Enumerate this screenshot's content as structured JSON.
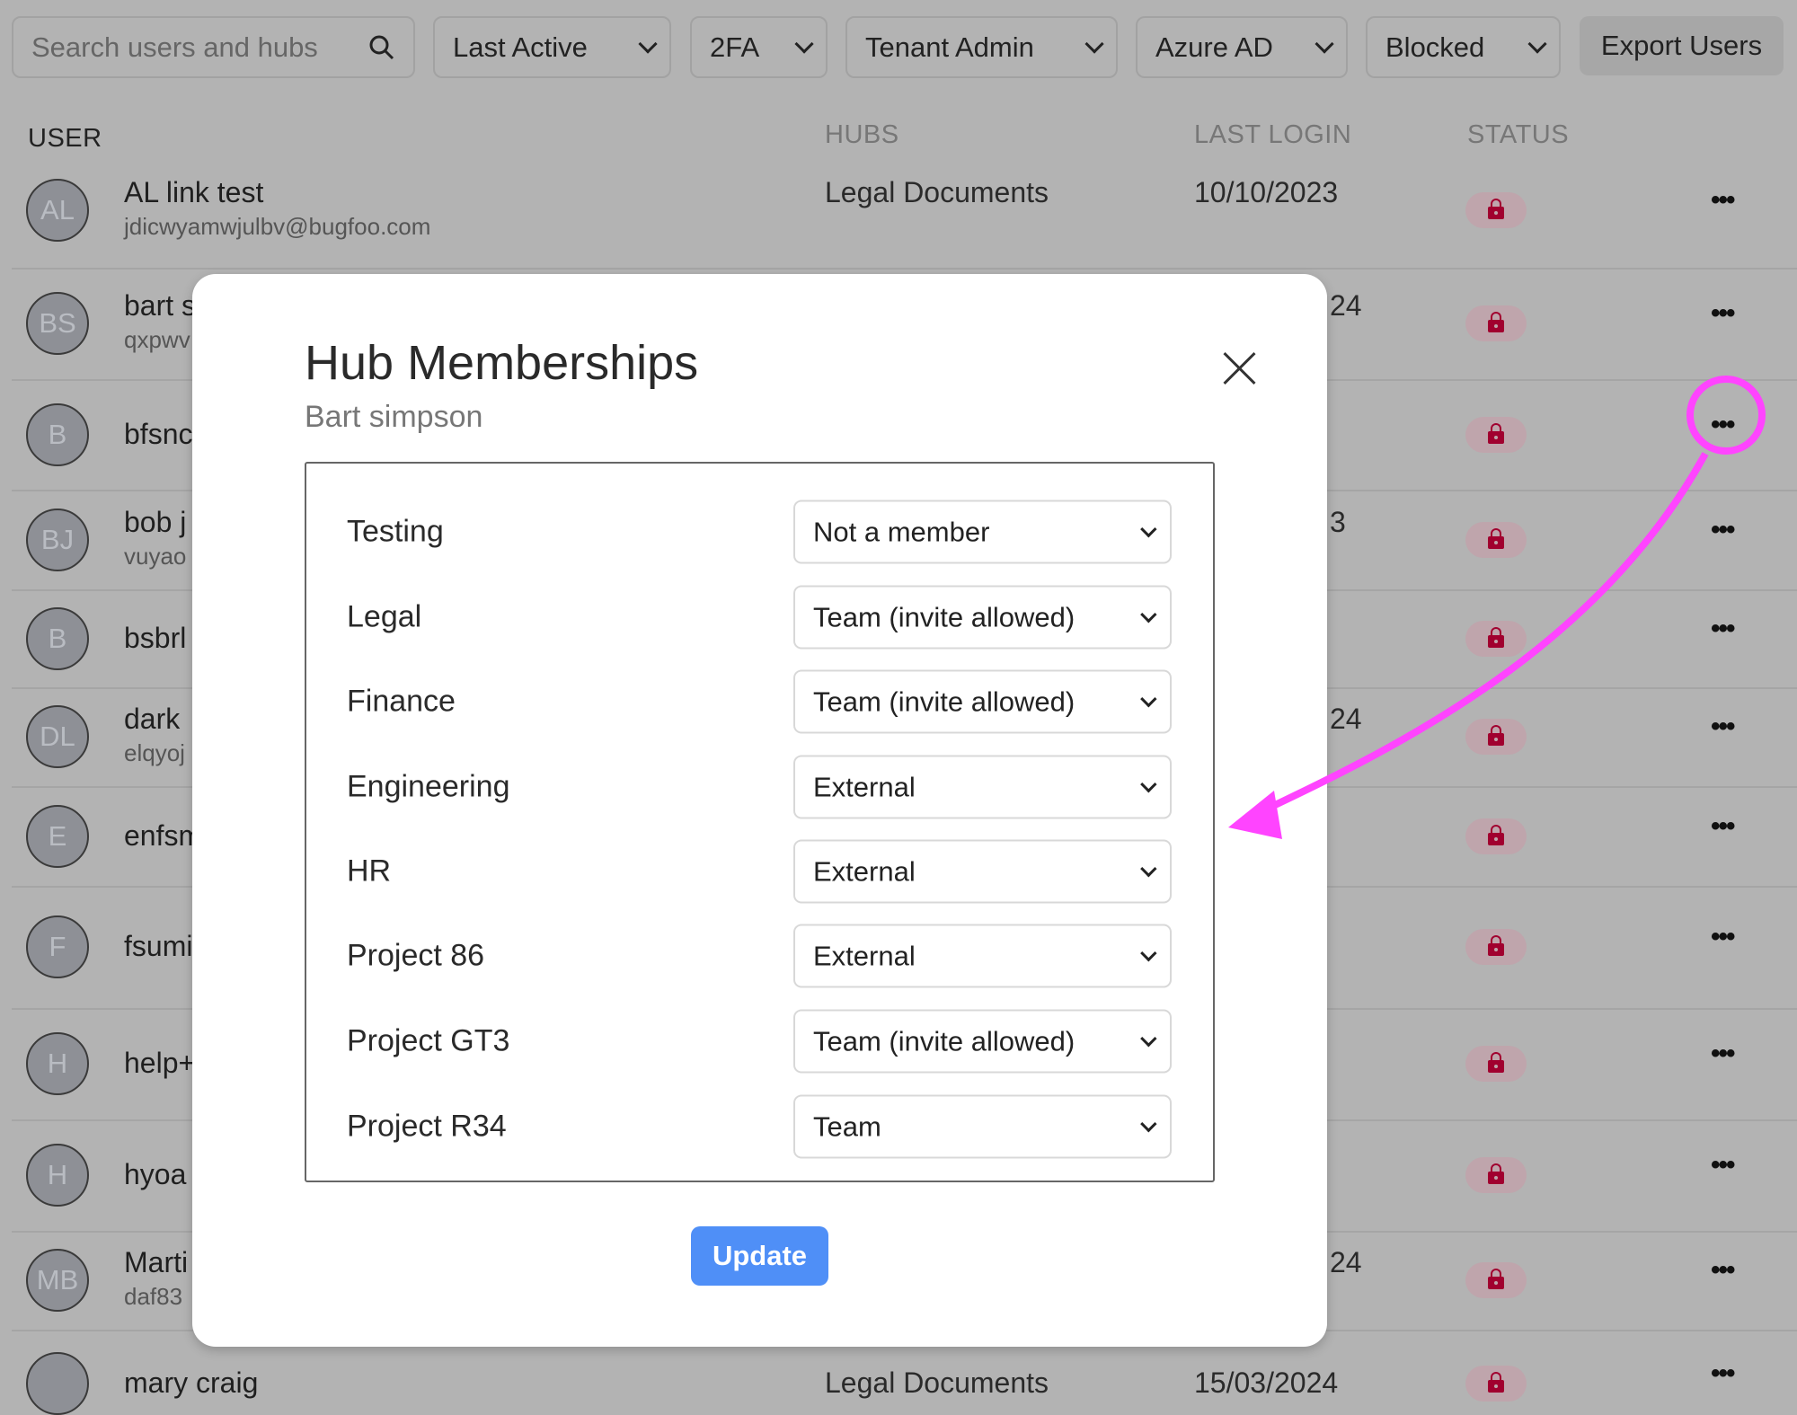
{
  "toolbar": {
    "search_placeholder": "Search users and hubs",
    "filters": [
      "Last Active",
      "2FA",
      "Tenant Admin",
      "Azure AD",
      "Blocked"
    ],
    "export_label": "Export Users"
  },
  "table": {
    "headers": {
      "user": "USER",
      "hubs": "HUBS",
      "last_login": "LAST LOGIN",
      "status": "STATUS"
    },
    "rows": [
      {
        "initials": "AL",
        "name": "AL link test",
        "email": "jdicwyamwjulbv@bugfoo.com",
        "hubs": "Legal Documents",
        "last_login": "10/10/2023",
        "status": "blocked"
      },
      {
        "initials": "BS",
        "name": "bart s",
        "email": "qxpwv",
        "hubs": "",
        "last_login": "24",
        "status": "blocked"
      },
      {
        "initials": "B",
        "name": "bfsnc",
        "email": "",
        "hubs": "",
        "last_login": "",
        "status": "blocked"
      },
      {
        "initials": "BJ",
        "name": "bob j",
        "email": "vuyao",
        "hubs": "",
        "last_login": "3",
        "status": "blocked"
      },
      {
        "initials": "B",
        "name": "bsbrl",
        "email": "",
        "hubs": "",
        "last_login": "",
        "status": "blocked"
      },
      {
        "initials": "DL",
        "name": "dark",
        "email": "elqyoj",
        "hubs": "",
        "last_login": "24",
        "status": "blocked"
      },
      {
        "initials": "E",
        "name": "enfsm",
        "email": "",
        "hubs": "",
        "last_login": "",
        "status": "blocked"
      },
      {
        "initials": "F",
        "name": "fsumi",
        "email": "",
        "hubs": "",
        "last_login": "",
        "status": "blocked"
      },
      {
        "initials": "H",
        "name": "help+",
        "email": "",
        "hubs": "",
        "last_login": "",
        "status": "blocked"
      },
      {
        "initials": "H",
        "name": "hyoa",
        "email": "",
        "hubs": "",
        "last_login": "",
        "status": "blocked"
      },
      {
        "initials": "MB",
        "name": "Marti",
        "email": "daf83",
        "hubs": "",
        "last_login": "24",
        "status": "blocked"
      },
      {
        "initials": "",
        "name": "mary craig",
        "email": "",
        "hubs": "Legal Documents",
        "last_login": "15/03/2024",
        "status": "blocked"
      }
    ]
  },
  "modal": {
    "title": "Hub Memberships",
    "subtitle": "Bart simpson",
    "memberships": [
      {
        "hub": "Testing",
        "role": "Not a member"
      },
      {
        "hub": "Legal",
        "role": "Team (invite allowed)"
      },
      {
        "hub": "Finance",
        "role": "Team (invite allowed)"
      },
      {
        "hub": "Engineering",
        "role": "External"
      },
      {
        "hub": "HR",
        "role": "External"
      },
      {
        "hub": "Project 86",
        "role": "External"
      },
      {
        "hub": "Project GT3",
        "role": "Team (invite allowed)"
      },
      {
        "hub": "Project R34",
        "role": "Team"
      }
    ],
    "update_label": "Update"
  },
  "colors": {
    "accent": "#4f8ff7",
    "blocked": "#a1002f",
    "annotation": "#ff44ff"
  },
  "icons": {
    "search": "search-icon",
    "chevron": "chevron-down-icon",
    "status": "lock-icon",
    "more": "more-horizontal-icon",
    "close": "close-icon"
  }
}
